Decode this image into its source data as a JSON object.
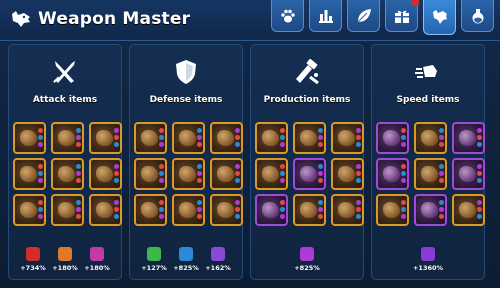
{
  "header": {
    "title": "Weapon Master",
    "tabs": [
      {
        "icon": "paw-icon",
        "active": false
      },
      {
        "icon": "bar-chart-icon",
        "active": false
      },
      {
        "icon": "leaf-icon",
        "active": false
      },
      {
        "icon": "gift-icon",
        "active": false,
        "notification": true
      },
      {
        "icon": "wolf-icon",
        "active": true
      },
      {
        "icon": "potion-icon",
        "active": false
      }
    ]
  },
  "panels": [
    {
      "title": "Attack items",
      "icon": "crossed-swords-icon",
      "items": [
        "gold",
        "gold",
        "gold",
        "gold",
        "gold",
        "gold",
        "gold",
        "gold",
        "gold"
      ],
      "bonuses": [
        {
          "icon": "sword-stat-icon",
          "color": "#d42b2b",
          "value": "+734%"
        },
        {
          "icon": "fire-stat-icon",
          "color": "#e0782a",
          "value": "+180%"
        },
        {
          "icon": "magic-stat-icon",
          "color": "#c23aa8",
          "value": "+180%"
        }
      ]
    },
    {
      "title": "Defense items",
      "icon": "shield-icon",
      "items": [
        "gold",
        "gold",
        "gold",
        "gold",
        "gold",
        "gold",
        "gold",
        "gold",
        "gold"
      ],
      "bonuses": [
        {
          "icon": "heal-stat-icon",
          "color": "#3ab84a",
          "value": "+127%"
        },
        {
          "icon": "armor-stat-icon",
          "color": "#2a8ad8",
          "value": "+825%"
        },
        {
          "icon": "wolf-stat-icon",
          "color": "#8a4ad8",
          "value": "+162%"
        }
      ]
    },
    {
      "title": "Production items",
      "icon": "production-icon",
      "items": [
        "gold",
        "gold",
        "gold",
        "gold",
        "epic",
        "gold",
        "epic",
        "gold",
        "gold"
      ],
      "bonuses": [
        {
          "icon": "book-stat-icon",
          "color": "#b03ad8",
          "value": "+825%"
        }
      ]
    },
    {
      "title": "Speed items",
      "icon": "speed-icon",
      "items": [
        "epic",
        "gold",
        "epic",
        "epic",
        "gold",
        "epic",
        "gold",
        "epic",
        "gold"
      ],
      "bonuses": [
        {
          "icon": "speed-stat-icon",
          "color": "#8a3ad8",
          "value": "+1360%"
        }
      ]
    }
  ]
}
